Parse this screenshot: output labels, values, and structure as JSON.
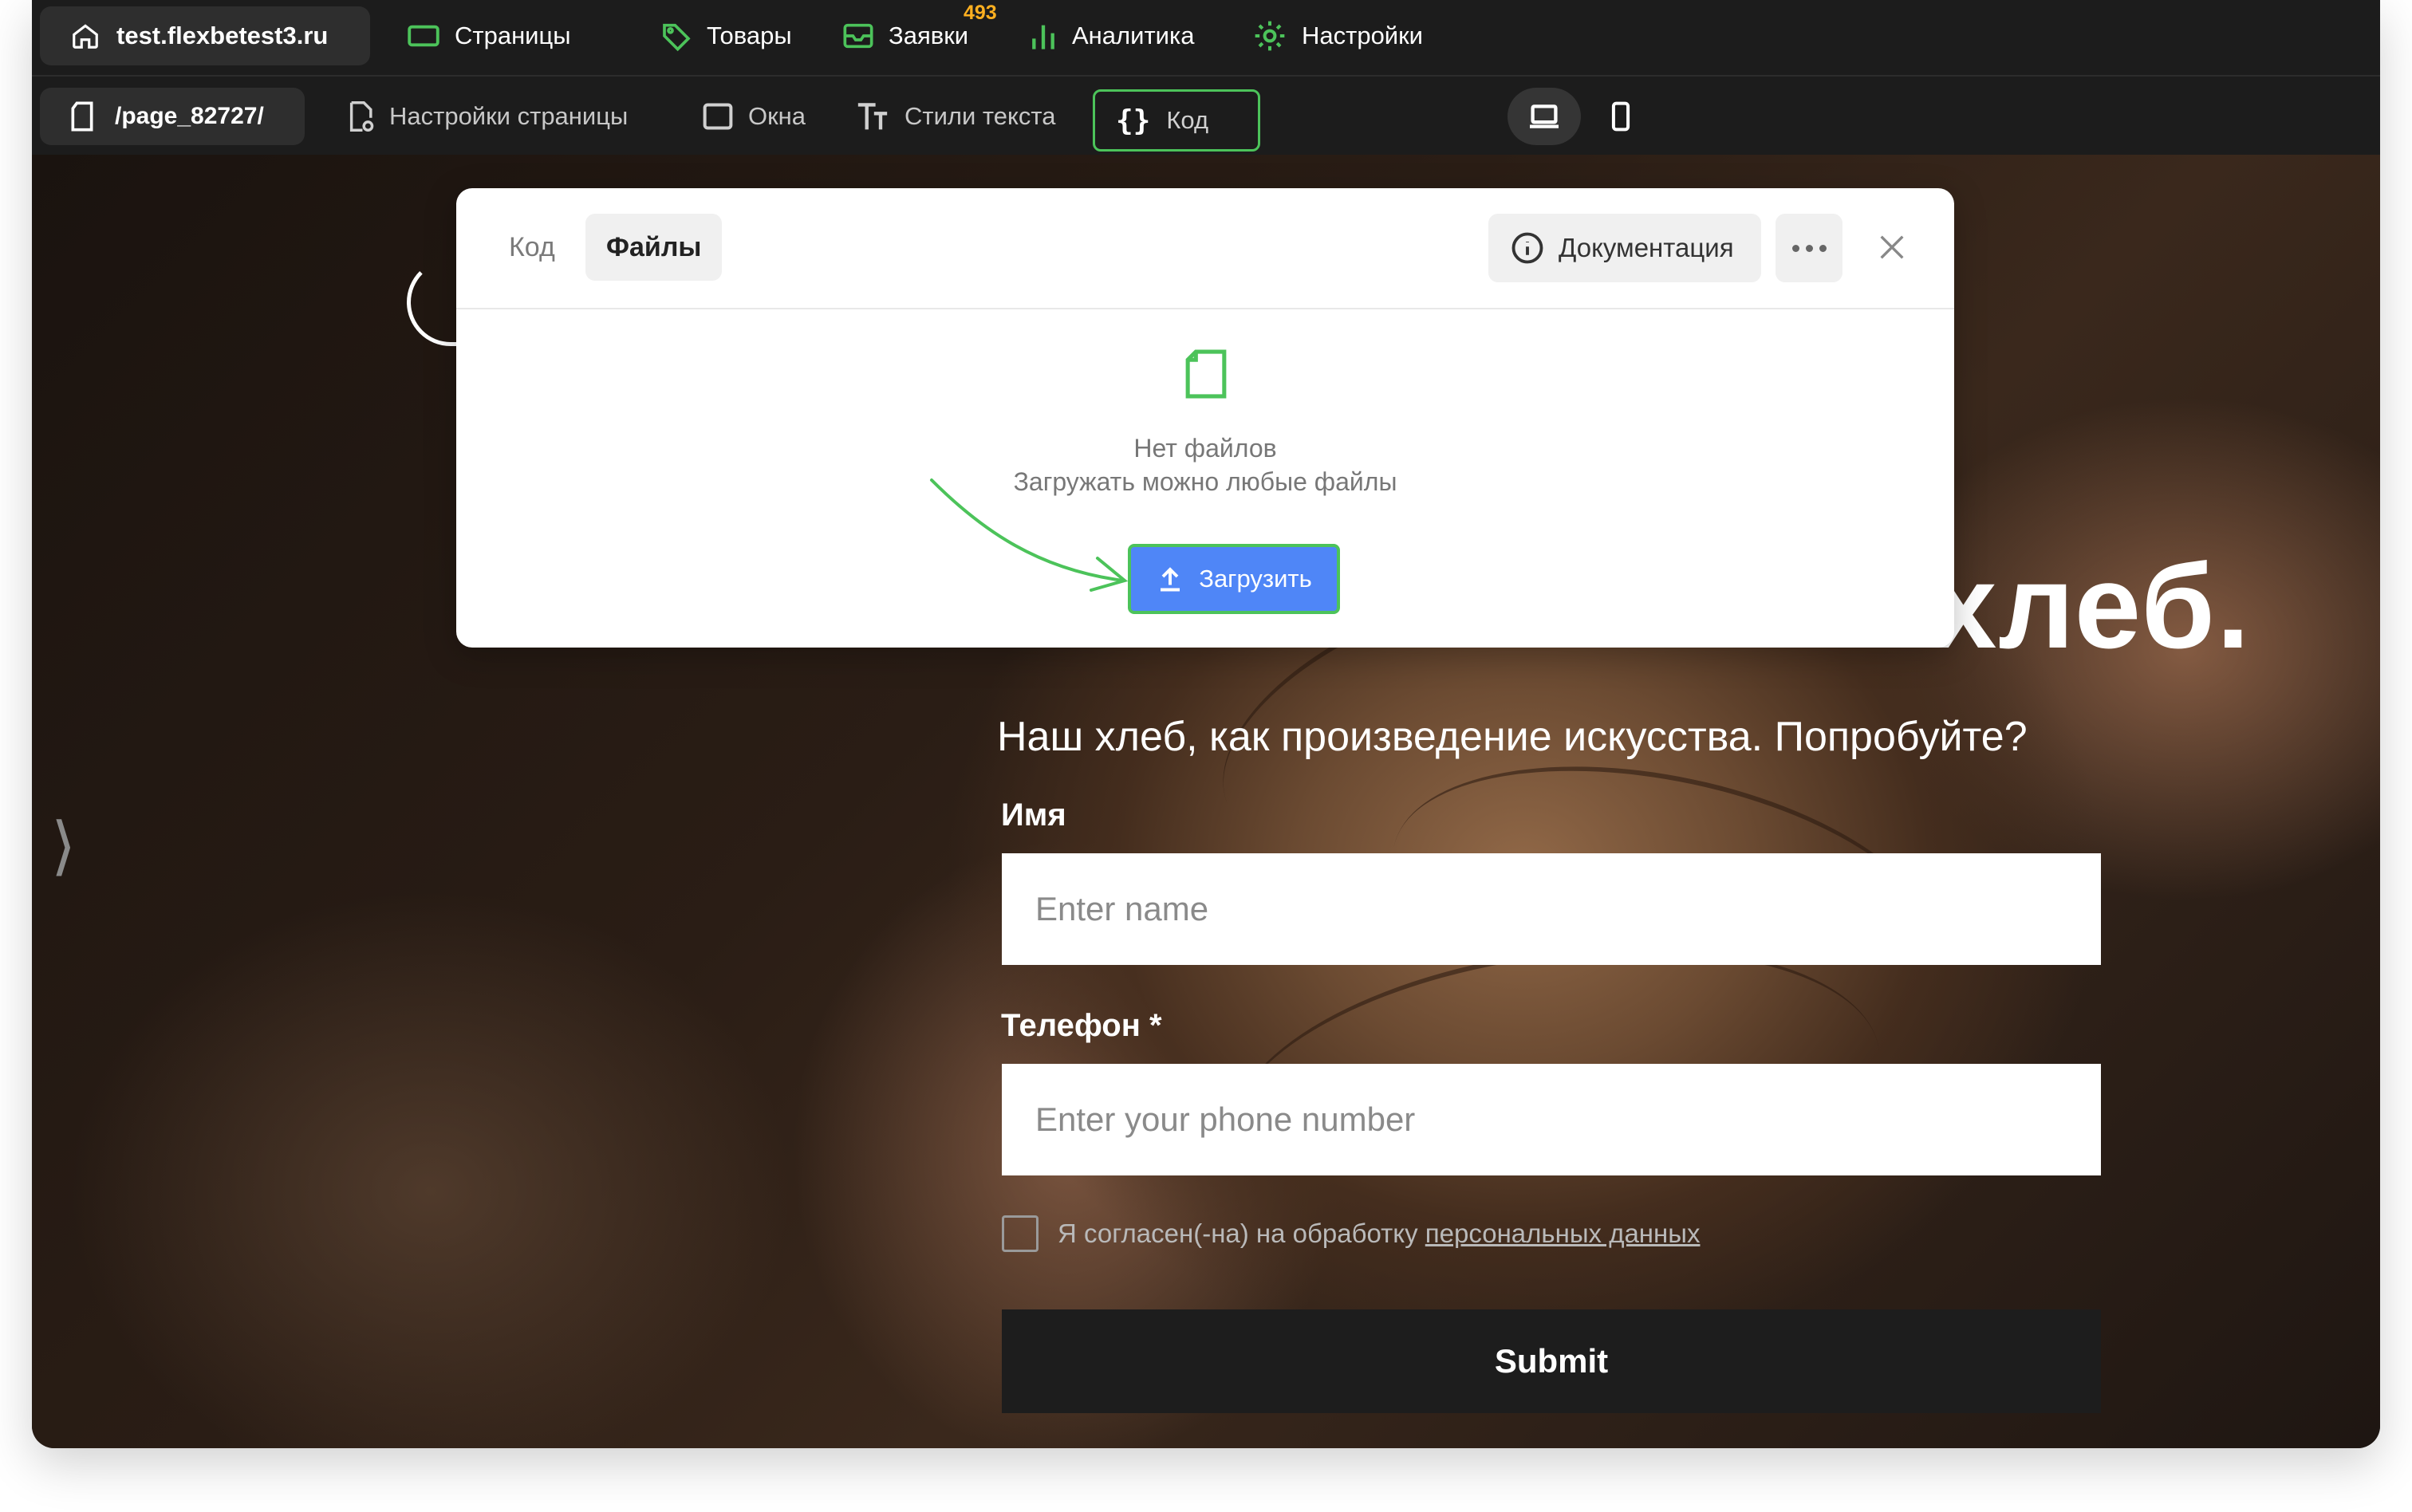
{
  "topbar": {
    "site": "test.flexbetest3.ru",
    "nav": [
      {
        "label": "Страницы",
        "icon": "pages-icon"
      },
      {
        "label": "Товары",
        "icon": "tag-icon"
      },
      {
        "label": "Заявки",
        "icon": "inbox-icon",
        "badge": "493"
      },
      {
        "label": "Аналитика",
        "icon": "chart-icon"
      },
      {
        "label": "Настройки",
        "icon": "gear-icon"
      }
    ]
  },
  "toolbar": {
    "path": "/page_82727/",
    "page_settings": "Настройки страницы",
    "windows": "Окна",
    "text_styles": "Стили текста",
    "code": "Код"
  },
  "modal": {
    "tabs": [
      "Код",
      "Файлы"
    ],
    "active_tab": "Файлы",
    "docs": "Документация",
    "empty_title": "Нет файлов",
    "empty_sub": "Загружать можно любые файлы",
    "upload": "Загрузить"
  },
  "page": {
    "hero_title_tail": "хлеб.",
    "hero_sub": "Наш хлеб, как произведение искусства. Попробуйте?",
    "name_label": "Имя",
    "name_placeholder": "Enter name",
    "phone_label": "Телефон *",
    "phone_placeholder": "Enter your phone number",
    "consent_text": "Я согласен(-на) на обработку ",
    "consent_link": "персональных данных",
    "submit": "Submit"
  },
  "colors": {
    "accent_green": "#4cc35a",
    "upload_blue": "#4f86f7",
    "badge_orange": "#ffb020",
    "topbar_bg": "#1c1c1c"
  }
}
